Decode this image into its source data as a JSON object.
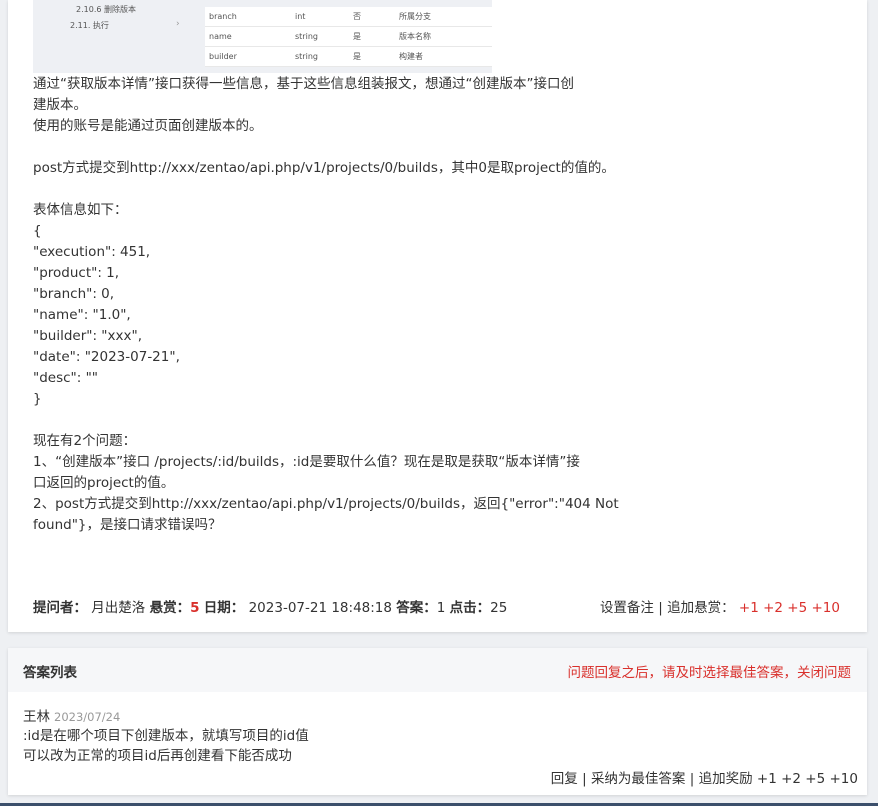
{
  "thumbnail": {
    "toc": [
      "2.10.6 删除版本",
      "2.11. 执行"
    ],
    "rows": [
      [
        "branch",
        "int",
        "否",
        "所属分支"
      ],
      [
        "name",
        "string",
        "是",
        "版本名称"
      ],
      [
        "builder",
        "string",
        "是",
        "构建者"
      ]
    ]
  },
  "question": {
    "lines": [
      "通过“获取版本详情”接口获得一些信息，基于这些信息组装报文，想通过“创建版本”接口创",
      "建版本。",
      "使用的账号是能通过页面创建版本的。",
      "post方式提交到http://xxx/zentao/api.php/v1/projects/0/builds，其中0是取project的值的。",
      "表体信息如下：",
      "{",
      " \"execution\": 451,",
      " \"product\": 1,",
      " \"branch\": 0,",
      " \"name\": \"1.0\",",
      " \"builder\": \"xxx\",",
      " \"date\": \"2023-07-21\",",
      " \"desc\": \"\"",
      "}",
      "现在有2个问题：",
      "1、“创建版本”接口 /projects/:id/builds，:id是要取什么值？现在是取是获取“版本详情”接",
      "口返回的project的值。",
      "2、post方式提交到http://xxx/zentao/api.php/v1/projects/0/builds，返回{\"error\":\"404 Not",
      "found\"}，是接口请求错误吗？"
    ]
  },
  "meta": {
    "asker_label": "提问者：",
    "asker": "月出楚洛",
    "bounty_label": "悬赏：",
    "bounty": "5",
    "date_label": "日期：",
    "date": "2023-07-21 18:48:18",
    "answers_label": "答案：",
    "answers": "1",
    "clicks_label": "点击：",
    "clicks": "25",
    "set_note": "设置备注",
    "add_bounty_label": "追加悬赏：",
    "add_options": [
      "+1",
      "+2",
      "+5",
      "+10"
    ]
  },
  "answers_section": {
    "title": "答案列表",
    "tip": "问题回复之后，请及时选择最佳答案，关闭问题",
    "answer": {
      "user": "王林",
      "date": "2023/07/24",
      "lines": [
        ":id是在哪个项目下创建版本，就填写项目的id值",
        "可以改为正常的项目id后再创建看下能否成功"
      ],
      "reply": "回复",
      "accept": "采纳为最佳答案",
      "reward_label": "追加奖励",
      "reward_options": [
        "+1",
        "+2",
        "+5",
        "+10"
      ]
    }
  },
  "colors": {
    "accent_red": "#d9302c",
    "page_bg": "#eef0f3",
    "bottom_bar": "#3b4f6b"
  }
}
